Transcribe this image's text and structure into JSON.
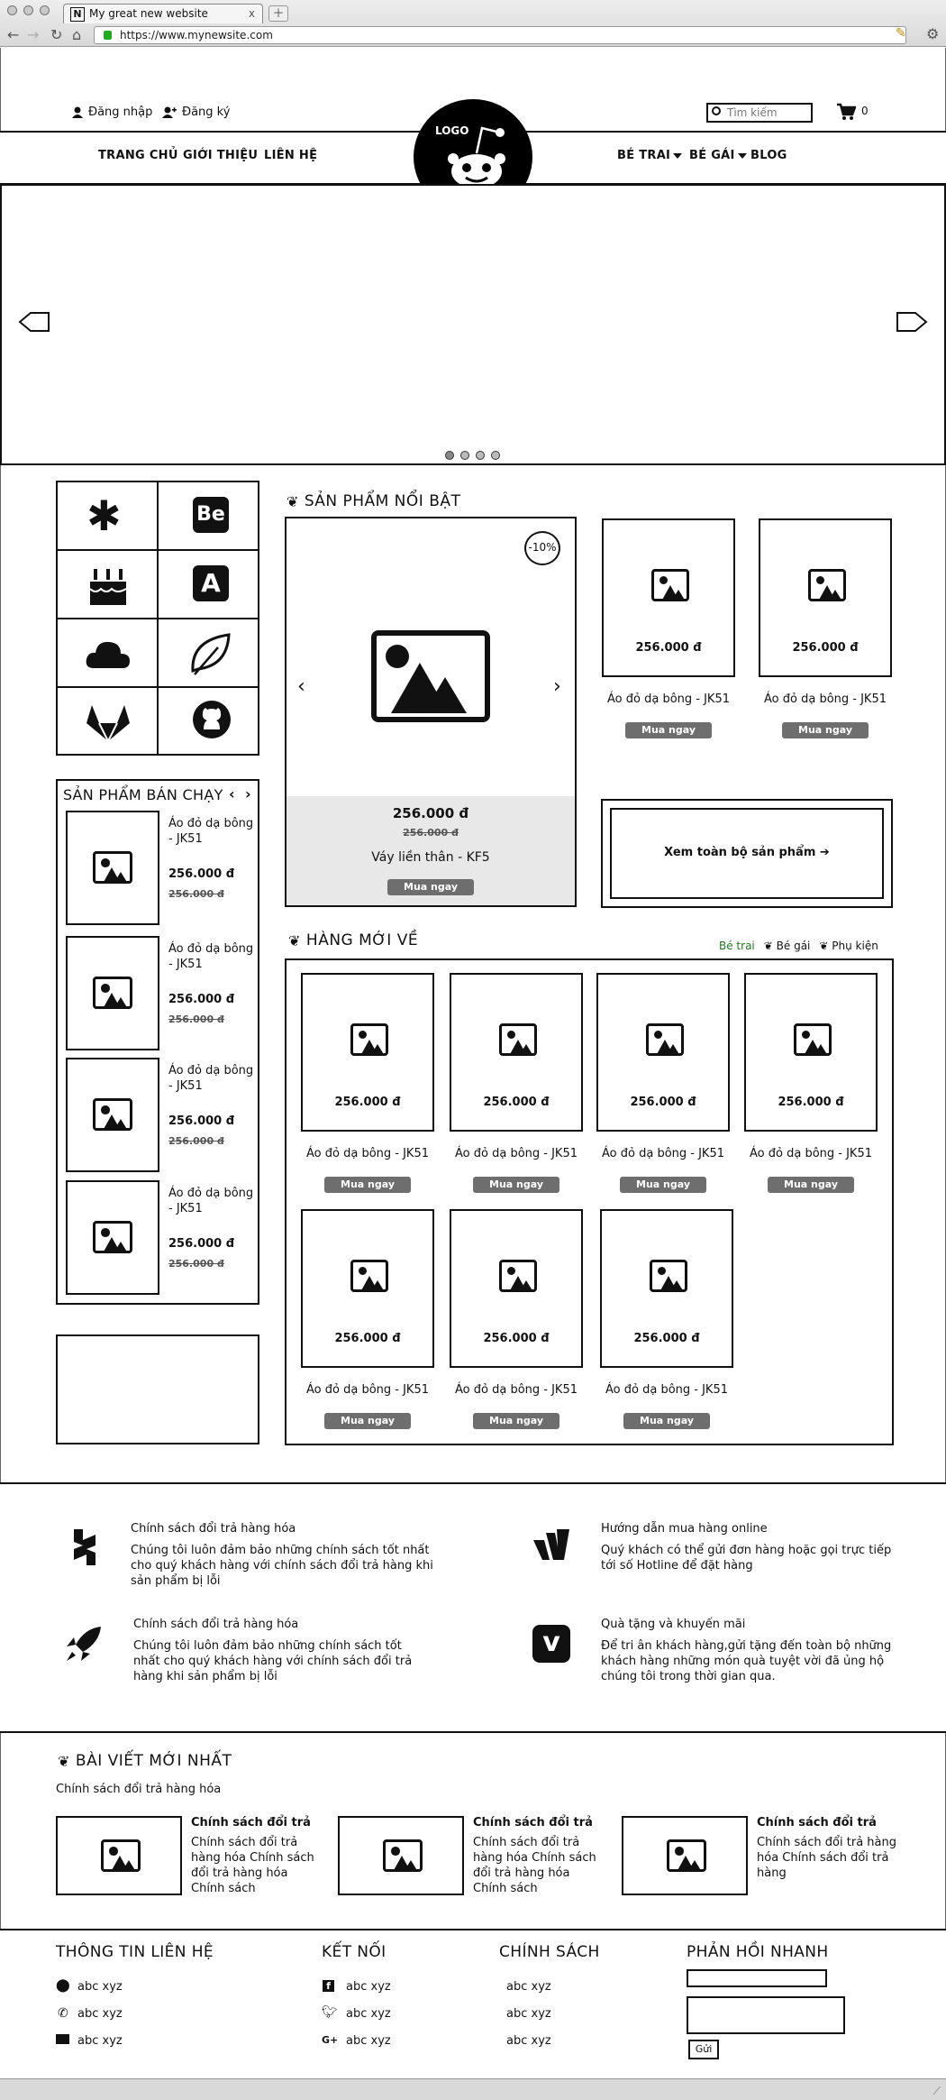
{
  "browser": {
    "tab_title": "My great new website",
    "tab_icon": "N",
    "tab_close": "x",
    "url": "https://www.mynewsite.com"
  },
  "header": {
    "login": "Đăng nhập",
    "register": "Đăng ký",
    "search_placeholder": "Tìm kiếm",
    "cart_count": "0",
    "logo_text": "LOGO"
  },
  "menu": {
    "left": [
      "TRANG CHỦ",
      "GIỚI THIỆU",
      "LIÊN HỆ"
    ],
    "right": [
      "BÉ TRAI",
      "BÉ GÁI",
      "BLOG"
    ]
  },
  "carousel": {
    "slide_count": 4,
    "active": 0
  },
  "category_icons": [
    "asterisk-icon",
    "behance-icon",
    "birthday-cake-icon",
    "autoprefixer-icon",
    "cloud-icon",
    "leaf-icon",
    "gitlab-icon",
    "github-icon"
  ],
  "bestseller": {
    "title": "SẢN PHẨM BÁN CHẠY",
    "items": [
      {
        "name": "Áo đỏ dạ bông - JK51",
        "price": "256.000 đ",
        "old_price": "256.000 đ"
      },
      {
        "name": "Áo đỏ dạ bông - JK51",
        "price": "256.000 đ",
        "old_price": "256.000 đ"
      },
      {
        "name": "Áo đỏ dạ bông - JK51",
        "price": "256.000 đ",
        "old_price": "256.000 đ"
      },
      {
        "name": "Áo đỏ dạ bông - JK51",
        "price": "256.000 đ",
        "old_price": "256.000 đ"
      }
    ]
  },
  "featured": {
    "title": "SẢN PHẨM NỔI BẬT",
    "main": {
      "discount": "-10%",
      "price": "256.000 đ",
      "old_price": "256.000 đ",
      "name": "Váy liền thân - KF5",
      "buy": "Mua ngay"
    },
    "small": [
      {
        "price": "256.000 đ",
        "name": "Áo đỏ dạ bông - JK51",
        "buy": "Mua ngay"
      },
      {
        "price": "256.000 đ",
        "name": "Áo đỏ dạ bông - JK51",
        "buy": "Mua ngay"
      }
    ],
    "view_all": "Xem toàn bộ sản phẩm"
  },
  "new_arrivals": {
    "title": "HÀNG MỚI VỀ",
    "filters": [
      "Bé trai",
      "Bé gái",
      "Phụ kiện"
    ],
    "active_filter_color": "#1f7a1f",
    "items": [
      {
        "price": "256.000 đ",
        "name": "Áo đỏ dạ bông - JK51",
        "buy": "Mua ngay"
      },
      {
        "price": "256.000 đ",
        "name": "Áo đỏ dạ bông - JK51",
        "buy": "Mua ngay"
      },
      {
        "price": "256.000 đ",
        "name": "Áo đỏ dạ bông - JK51",
        "buy": "Mua ngay"
      },
      {
        "price": "256.000 đ",
        "name": "Áo đỏ dạ bông - JK51",
        "buy": "Mua ngay"
      },
      {
        "price": "256.000 đ",
        "name": "Áo đỏ dạ bông - JK51",
        "buy": "Mua ngay"
      },
      {
        "price": "256.000 đ",
        "name": "Áo đỏ dạ bông - JK51",
        "buy": "Mua ngay"
      },
      {
        "price": "256.000 đ",
        "name": "Áo đỏ dạ bông - JK51",
        "buy": "Mua ngay"
      }
    ]
  },
  "policies": [
    {
      "icon": "hotjar-icon",
      "title": "Chính sách đổi trả hàng hóa",
      "text": "Chúng tôi luôn đảm bảo những chính sách tốt nhất cho quý khách hàng với chính sách đổi trả hàng khi sản phẩm bị lỗi"
    },
    {
      "icon": "wpressr-icon",
      "title": "Hướng dẫn mua hàng online",
      "text": "Quý khách có thể gửi đơn hàng hoặc gọi trực tiếp tới số Hotline để đặt hàng"
    },
    {
      "icon": "rocket-icon",
      "title": "Chính sách đổi trả hàng hóa",
      "text": "Chúng tôi luôn đảm bảo những chính sách tốt nhất cho quý khách hàng với chính sách đổi trả hàng khi sản phẩm bị lỗi"
    },
    {
      "icon": "vimeo-icon",
      "title": "Quà tặng và khuyến mãi",
      "text": "Để tri ân khách hàng,gửi tặng đến toàn bộ những khách hàng những món quà tuyệt vời đã ủng hộ chúng tôi trong thời gian qua."
    }
  ],
  "blog": {
    "title": "BÀI VIẾT MỚI NHẤT",
    "subtitle": "Chính sách đổi trả hàng hóa",
    "posts": [
      {
        "title": "Chính sách đổi trả",
        "text": "Chính sách đổi trả hàng hóa Chính sách đổi trả hàng hóa Chính sách"
      },
      {
        "title": "Chính sách đổi trả",
        "text": "Chính sách đổi trả hàng hóa Chính sách đổi trả hàng hóa Chính sách"
      },
      {
        "title": "Chính sách đổi trả",
        "text": "Chính sách đổi trả hàng hóa Chính sách đổi trả hàng"
      }
    ]
  },
  "footer": {
    "contact": {
      "title": "THÔNG TIN LIÊN HỆ",
      "items": [
        "abc xyz",
        "abc xyz",
        "abc xyz"
      ]
    },
    "connect": {
      "title": "KẾT NỐI",
      "items": [
        "abc xyz",
        "abc xyz",
        "abc xyz"
      ]
    },
    "policy": {
      "title": "CHÍNH SÁCH",
      "items": [
        "abc xyz",
        "abc xyz",
        "abc xyz"
      ]
    },
    "feedback": {
      "title": "PHẢN HỒI NHANH",
      "submit": "Gửi"
    }
  }
}
